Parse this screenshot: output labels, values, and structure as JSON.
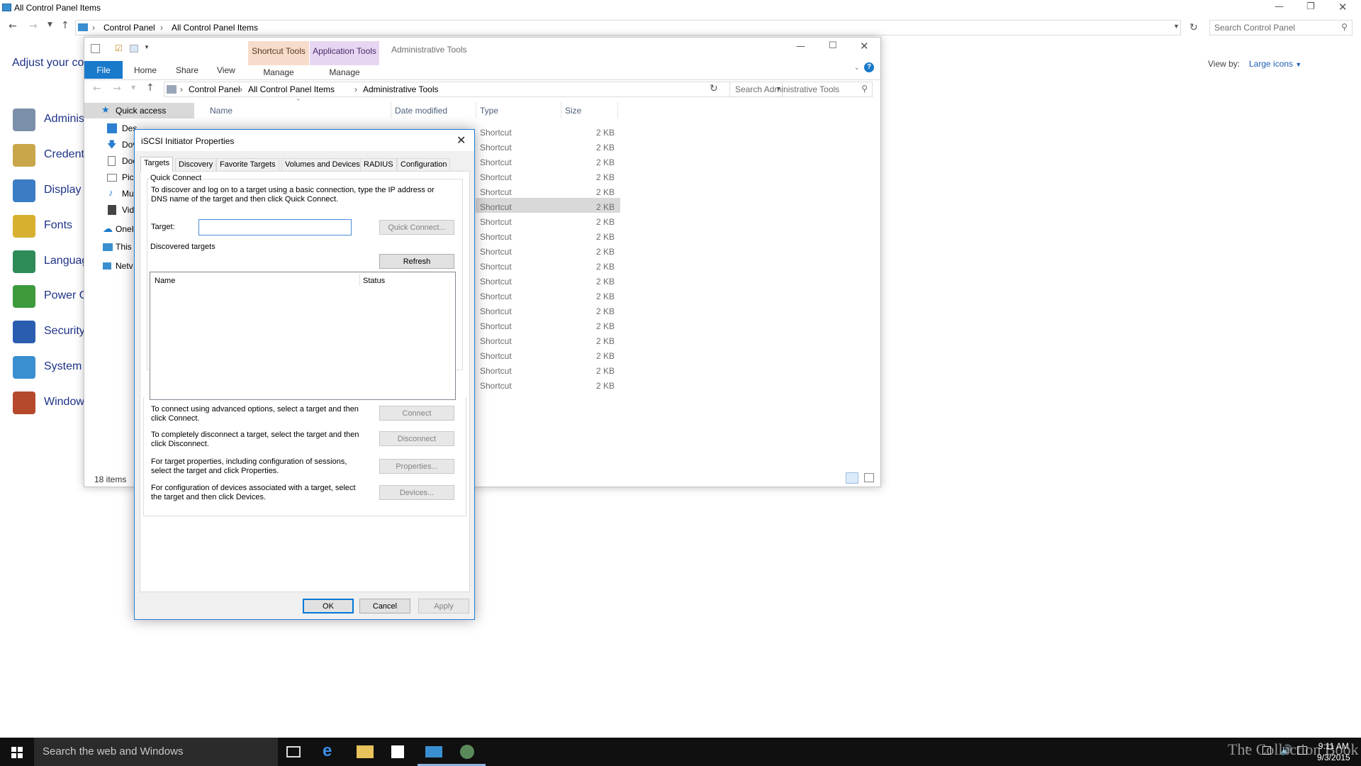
{
  "control_panel": {
    "window_title": "All Control Panel Items",
    "breadcrumb": [
      "Control Panel",
      "All Control Panel Items"
    ],
    "search_placeholder": "Search Control Panel",
    "heading": "Adjust your co",
    "view_by_label": "View by:",
    "view_by_value": "Large icons",
    "items": [
      {
        "label": "Adminis",
        "icon": "admin-tools-icon",
        "color": "#7b8fa8"
      },
      {
        "label": "Credenti",
        "icon": "credential-icon",
        "color": "#c9a64a"
      },
      {
        "label": "Display",
        "icon": "display-icon",
        "color": "#3a7dc4"
      },
      {
        "label": "Fonts",
        "icon": "fonts-icon",
        "color": "#d8b030"
      },
      {
        "label": "Languag",
        "icon": "language-icon",
        "color": "#2e8b57"
      },
      {
        "label": "Power O",
        "icon": "power-options-icon",
        "color": "#3c9a3c"
      },
      {
        "label": "Security",
        "icon": "security-flag-icon",
        "color": "#2a5db0"
      },
      {
        "label": "System",
        "icon": "system-icon",
        "color": "#3a8fd0"
      },
      {
        "label": "Window",
        "icon": "windows-firewall-icon",
        "color": "#b5492c"
      }
    ]
  },
  "explorer": {
    "title": "Administrative Tools",
    "context_tabs": [
      {
        "label": "Shortcut Tools",
        "sub": "Manage"
      },
      {
        "label": "Application Tools",
        "sub": "Manage"
      }
    ],
    "ribbon_tabs": [
      "File",
      "Home",
      "Share",
      "View"
    ],
    "breadcrumb": [
      "Control Panel",
      "All Control Panel Items",
      "Administrative Tools"
    ],
    "search_placeholder": "Search Administrative Tools",
    "nav": [
      {
        "label": "Quick access",
        "icon": "star-icon"
      },
      {
        "label": "Des",
        "icon": "desktop-icon"
      },
      {
        "label": "Dov",
        "icon": "downloads-icon"
      },
      {
        "label": "Doc",
        "icon": "documents-icon"
      },
      {
        "label": "Pic",
        "icon": "pictures-icon"
      },
      {
        "label": "Mu",
        "icon": "music-icon"
      },
      {
        "label": "Vid",
        "icon": "videos-icon"
      },
      {
        "label": "OneI",
        "icon": "onedrive-icon"
      },
      {
        "label": "This",
        "icon": "this-pc-icon"
      },
      {
        "label": "Netv",
        "icon": "network-icon"
      }
    ],
    "columns": {
      "name": "Name",
      "date": "Date modified",
      "type": "Type",
      "size": "Size"
    },
    "rows": [
      {
        "type": "Shortcut",
        "size": "2 KB"
      },
      {
        "type": "Shortcut",
        "size": "2 KB"
      },
      {
        "type": "Shortcut",
        "size": "2 KB"
      },
      {
        "type": "Shortcut",
        "size": "2 KB"
      },
      {
        "type": "Shortcut",
        "size": "2 KB"
      },
      {
        "type": "Shortcut",
        "size": "2 KB"
      },
      {
        "type": "Shortcut",
        "size": "2 KB"
      },
      {
        "type": "Shortcut",
        "size": "2 KB"
      },
      {
        "type": "Shortcut",
        "size": "2 KB"
      },
      {
        "type": "Shortcut",
        "size": "2 KB"
      },
      {
        "type": "Shortcut",
        "size": "2 KB"
      },
      {
        "type": "Shortcut",
        "size": "2 KB"
      },
      {
        "type": "Shortcut",
        "size": "2 KB"
      },
      {
        "type": "Shortcut",
        "size": "2 KB"
      },
      {
        "type": "Shortcut",
        "size": "2 KB"
      },
      {
        "type": "Shortcut",
        "size": "2 KB"
      },
      {
        "type": "Shortcut",
        "size": "2 KB"
      },
      {
        "type": "Shortcut",
        "size": "2 KB"
      }
    ],
    "status": "18 items"
  },
  "dialog": {
    "title": "iSCSI Initiator Properties",
    "tabs": [
      "Targets",
      "Discovery",
      "Favorite Targets",
      "Volumes and Devices",
      "RADIUS",
      "Configuration"
    ],
    "quick_connect": {
      "group": "Quick Connect",
      "desc": "To discover and log on to a target using a basic connection, type the IP address or DNS name of the target and then click Quick Connect.",
      "target_label": "Target:",
      "target_value": "",
      "button": "Quick Connect..."
    },
    "discovered": {
      "group": "Discovered targets",
      "refresh": "Refresh",
      "col_name": "Name",
      "col_status": "Status"
    },
    "actions": [
      {
        "text": "To connect using advanced options, select a target and then click Connect.",
        "button": "Connect"
      },
      {
        "text": "To completely disconnect a target, select the target and then click Disconnect.",
        "button": "Disconnect"
      },
      {
        "text": "For target properties, including configuration of sessions, select the target and click Properties.",
        "button": "Properties..."
      },
      {
        "text": "For configuration of devices associated with a target, select the target and then click Devices.",
        "button": "Devices..."
      }
    ],
    "ok": "OK",
    "cancel": "Cancel",
    "apply": "Apply"
  },
  "taskbar": {
    "search_placeholder": "Search the web and Windows",
    "time": "9:11 AM",
    "date": "9/3/2015",
    "watermark": "The Collection Book"
  },
  "colors": {
    "accent": "#1979ca",
    "link": "#1e3287",
    "selection": "#d9d9d9"
  }
}
